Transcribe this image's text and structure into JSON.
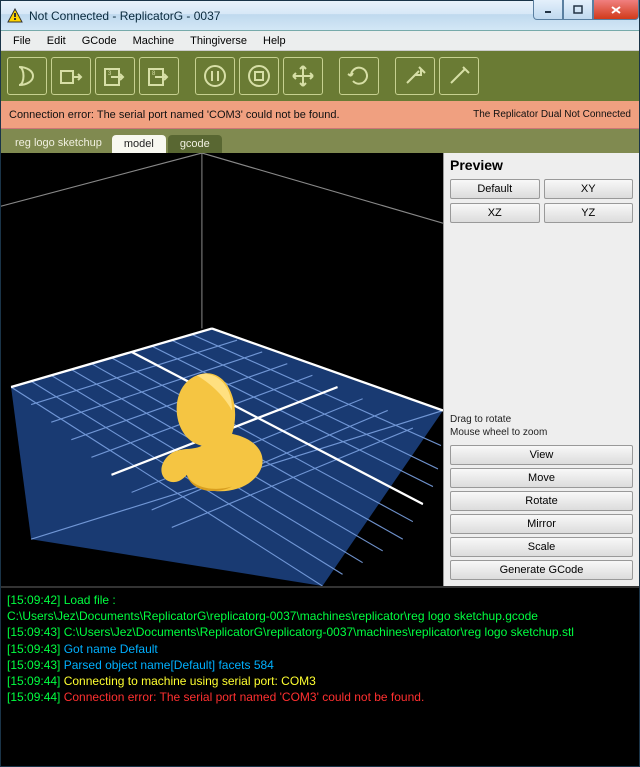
{
  "title": "Not Connected - ReplicatorG - 0037",
  "menus": [
    "File",
    "Edit",
    "GCode",
    "Machine",
    "Thingiverse",
    "Help"
  ],
  "error_bar": {
    "message": "Connection error: The serial port named 'COM3' could not be found.",
    "status": "The Replicator Dual Not Connected"
  },
  "tabs": {
    "project": "reg logo sketchup",
    "items": [
      "model",
      "gcode"
    ],
    "active": 0
  },
  "preview": {
    "title": "Preview",
    "row1": [
      "Default",
      "XY"
    ],
    "row2": [
      "XZ",
      "YZ"
    ],
    "hints": [
      "Drag to rotate",
      "Mouse wheel to zoom"
    ],
    "buttons": [
      "View",
      "Move",
      "Rotate",
      "Mirror",
      "Scale",
      "Generate GCode"
    ]
  },
  "console": [
    {
      "ts": "[15:09:42]",
      "cls": "file",
      "text": "Load file :"
    },
    {
      "ts": "",
      "cls": "file",
      "text": "C:\\Users\\Jez\\Documents\\ReplicatorG\\replicatorg-0037\\machines\\replicator\\reg logo sketchup.gcode"
    },
    {
      "ts": "[15:09:43]",
      "cls": "file",
      "text": "C:\\Users\\Jez\\Documents\\ReplicatorG\\replicatorg-0037\\machines\\replicator\\reg logo sketchup.stl"
    },
    {
      "ts": "[15:09:43]",
      "cls": "info",
      "text": "Got name Default"
    },
    {
      "ts": "[15:09:43]",
      "cls": "info",
      "text": "Parsed object name[Default] facets 584"
    },
    {
      "ts": "[15:09:44]",
      "cls": "act",
      "text": "Connecting to machine using serial port: COM3"
    },
    {
      "ts": "[15:09:44]",
      "cls": "err",
      "text": "Connection error: The serial port named 'COM3' could not be found."
    }
  ]
}
